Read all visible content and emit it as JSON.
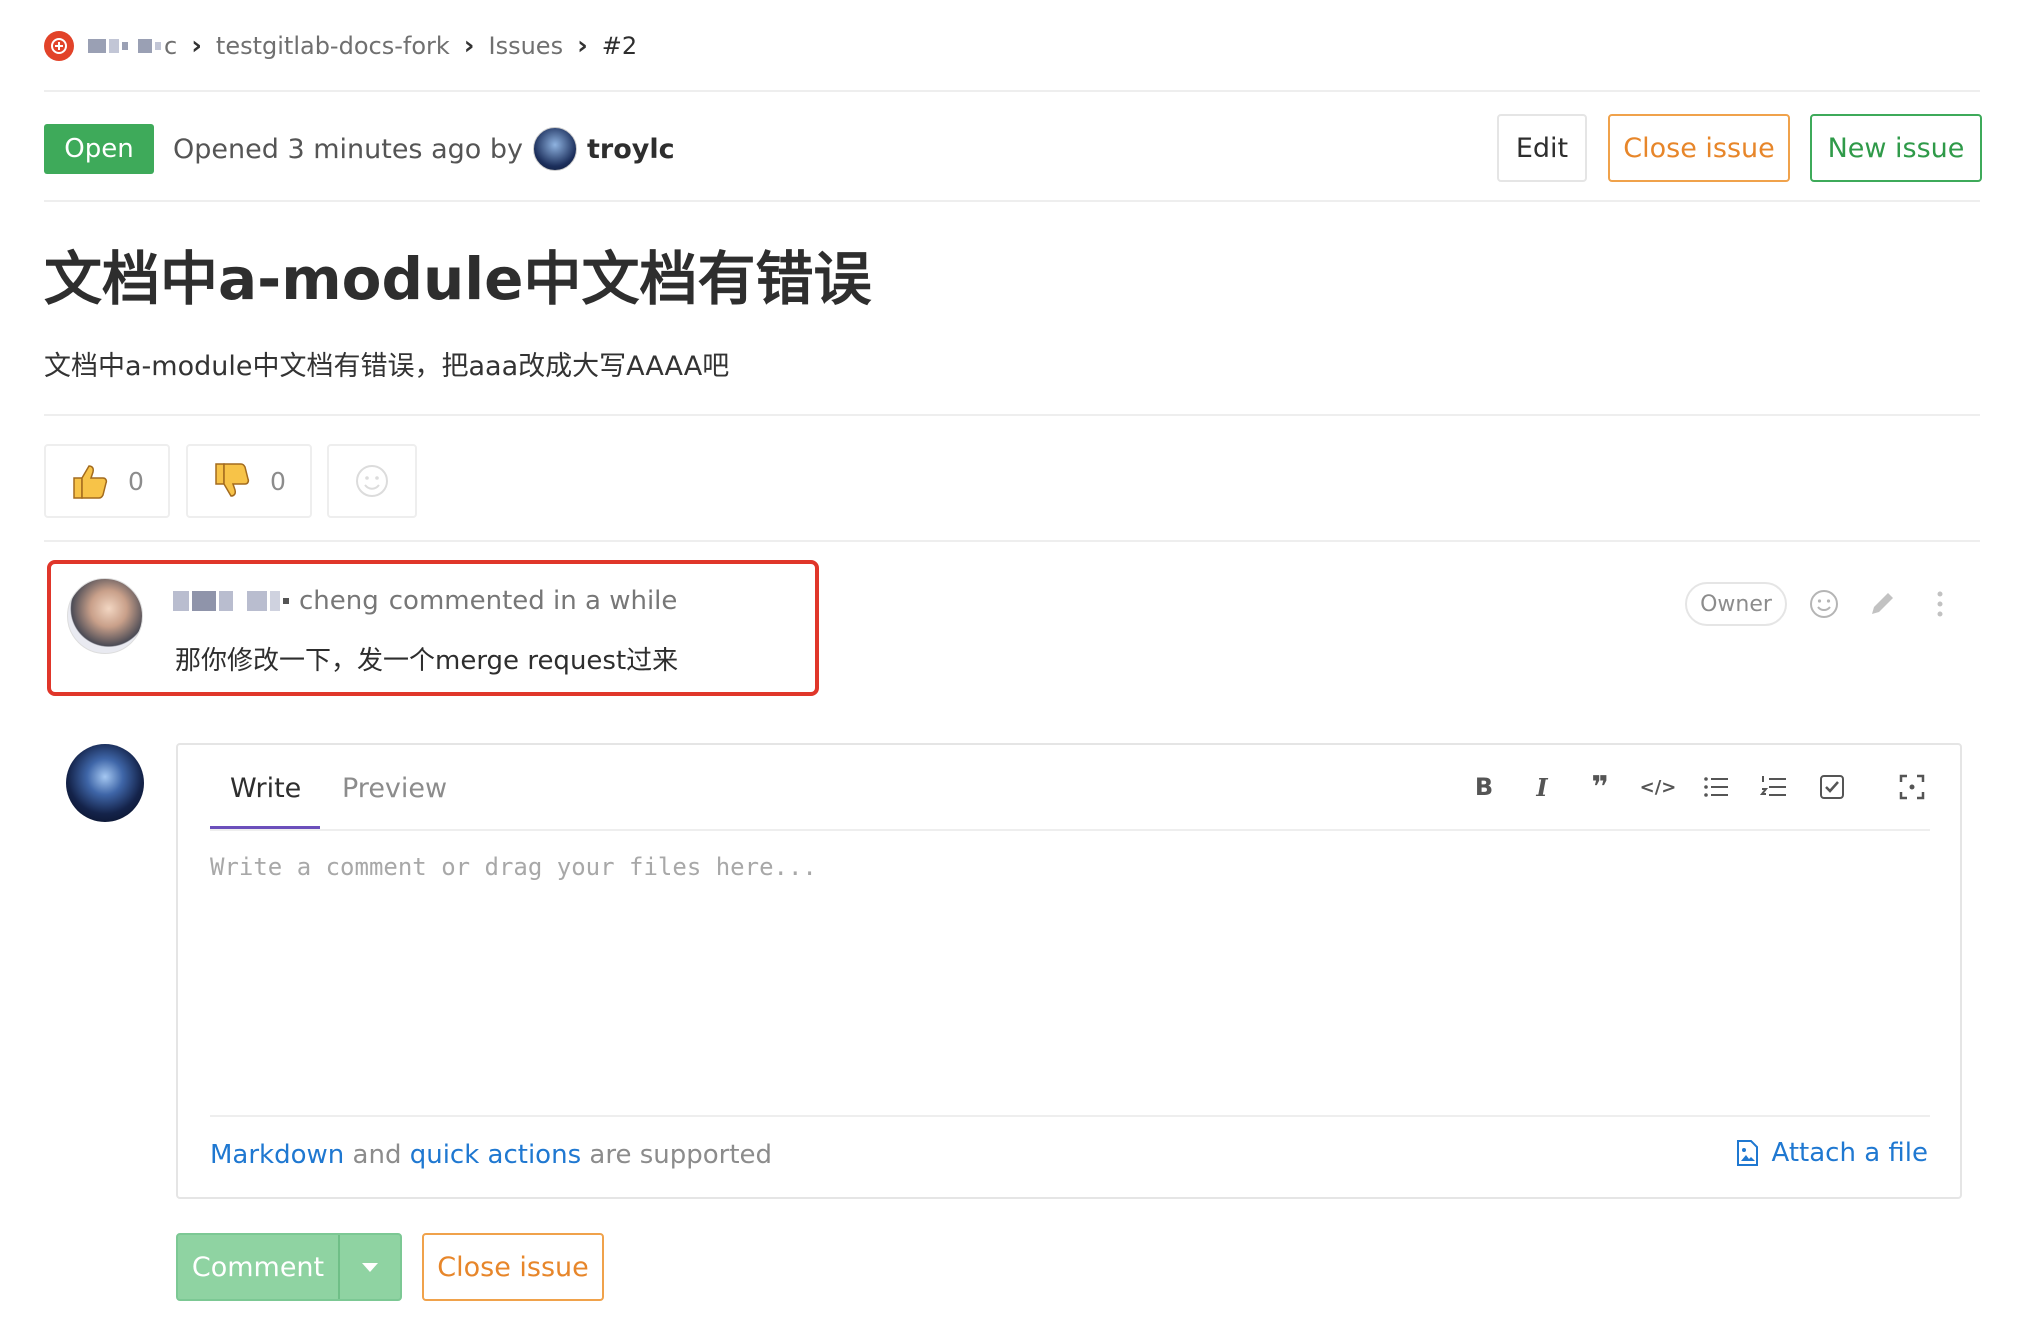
{
  "breadcrumb": {
    "group": "c",
    "project": "testgitlab-docs-fork",
    "section": "Issues",
    "current": "#2"
  },
  "issue": {
    "status": "Open",
    "opened_prefix": "Opened 3 minutes ago by",
    "author": "troylc",
    "title": "文档中a-module中文档有错误",
    "description": "文档中a-module中文档有错误，把aaa改成大写AAAA吧"
  },
  "header_buttons": {
    "edit": "Edit",
    "close": "Close issue",
    "new": "New issue"
  },
  "awards": {
    "thumbsup_count": "0",
    "thumbsdown_count": "0"
  },
  "note": {
    "author_suffix": "cheng",
    "meta": "commented in a while",
    "body": "那你修改一下，发一个merge request过来",
    "role_badge": "Owner"
  },
  "editor": {
    "tab_write": "Write",
    "tab_preview": "Preview",
    "placeholder": "Write a comment or drag your files here...",
    "markdown_link": "Markdown",
    "and_text": " and ",
    "quick_actions_link": "quick actions",
    "supported_text": " are supported",
    "attach_label": "Attach a file"
  },
  "footer_buttons": {
    "comment": "Comment",
    "close": "Close issue"
  },
  "colors": {
    "open_badge": "#3eaa5a",
    "warning": "#e7862a",
    "success": "#2f9a49",
    "link": "#1f78d1",
    "highlight_box": "#e0362a",
    "tab_active": "#6b4fbb"
  }
}
